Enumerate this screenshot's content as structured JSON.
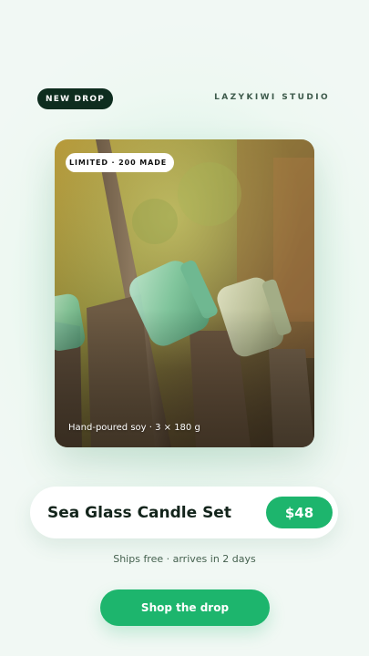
{
  "header": {
    "badge_label": "NEW DROP",
    "brand_label": "LAZYKIWI STUDIO"
  },
  "hero": {
    "limited_label": "LIMITED · 200 MADE",
    "caption": "Hand-poured soy · 3 × 180 g",
    "image_subject": "glass jars on wooden fence posts"
  },
  "product": {
    "name": "Sea Glass Candle Set",
    "price": "$48"
  },
  "shipping_note": "Ships free · arrives in 2 days",
  "cta_label": "Shop the drop",
  "colors": {
    "accent": "#1db56d",
    "badge_dark": "#0e2d1f",
    "background": "#eef8f2"
  }
}
